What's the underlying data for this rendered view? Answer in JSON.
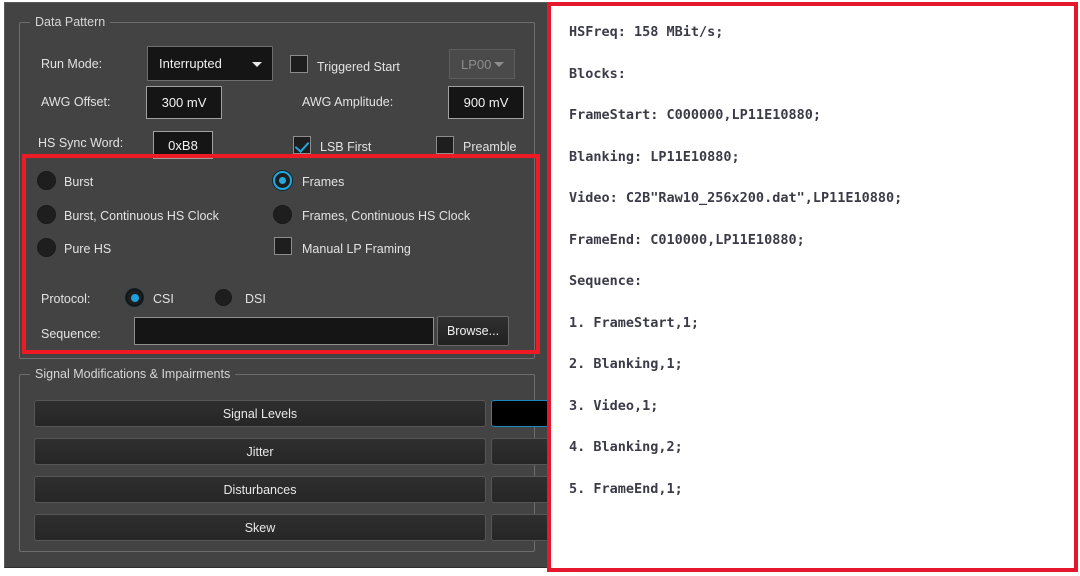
{
  "panel": {
    "data_pattern": {
      "title": "Data Pattern",
      "run_mode_label": "Run Mode:",
      "run_mode_value": "Interrupted",
      "triggered_start_label": "Triggered Start",
      "triggered_start_checked": false,
      "lp_state_value": "LP00",
      "awg_offset_label": "AWG Offset:",
      "awg_offset_value": "300 mV",
      "awg_amplitude_label": "AWG Amplitude:",
      "awg_amplitude_value": "900 mV",
      "hs_sync_word_label": "HS Sync Word:",
      "hs_sync_word_value": "0xB8",
      "lsb_first_label": "LSB First",
      "lsb_first_checked": true,
      "preamble_label": "Preamble",
      "preamble_checked": false,
      "modes": [
        {
          "label": "Burst",
          "selected": false
        },
        {
          "label": "Frames",
          "selected": true
        },
        {
          "label": "Burst, Continuous HS Clock",
          "selected": false
        },
        {
          "label": "Frames, Continuous HS Clock",
          "selected": false
        },
        {
          "label": "Pure HS",
          "selected": false
        }
      ],
      "manual_lp_framing_label": "Manual LP Framing",
      "manual_lp_framing_checked": false,
      "protocol_label": "Protocol:",
      "protocol_options": [
        {
          "label": "CSI",
          "selected": true
        },
        {
          "label": "DSI",
          "selected": false
        }
      ],
      "sequence_label": "Sequence:",
      "sequence_value": "",
      "browse_label": "Browse..."
    },
    "signal_mods": {
      "title": "Signal Modifications & Impairments",
      "buttons": [
        {
          "label": "Signal Levels"
        },
        {
          "label": "Jitter"
        },
        {
          "label": "Disturbances"
        },
        {
          "label": "Skew"
        }
      ]
    }
  },
  "script_panel": {
    "lines": [
      "HSFreq: 158 MBit/s;",
      "Blocks:",
      "FrameStart: C000000,LP11E10880;",
      "Blanking: LP11E10880;",
      "Video: C2B\"Raw10_256x200.dat\",LP11E10880;",
      "FrameEnd: C010000,LP11E10880;",
      "Sequence:",
      "1. FrameStart,1;",
      "2. Blanking,1;",
      "3. Video,1;",
      "4. Blanking,2;",
      "5. FrameEnd,1;"
    ]
  },
  "colors": {
    "accent_blue": "#1fa8e0",
    "annotation_red": "#ee1b24",
    "panel_bg": "#434343"
  }
}
